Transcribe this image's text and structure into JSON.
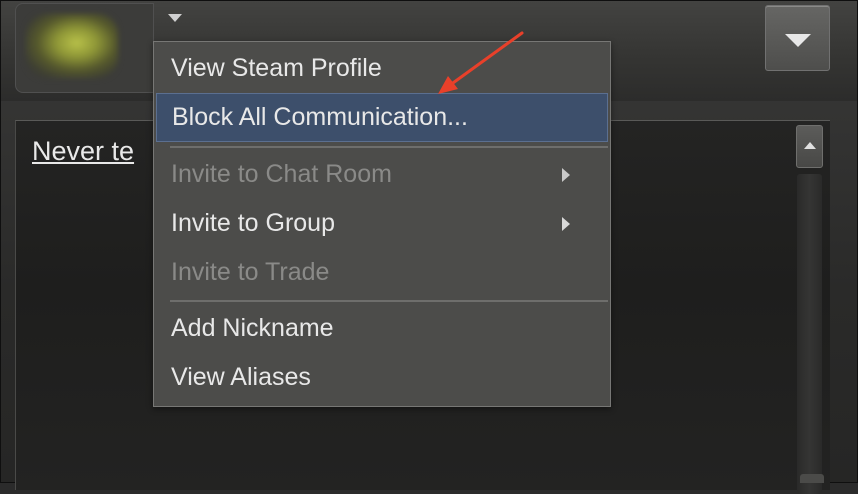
{
  "chat": {
    "link_text": "Never te"
  },
  "icons": {
    "avatar_caret": "caret-down-icon",
    "menu_toggle": "chevron-down-icon",
    "scroll_up": "scroll-up-arrow-icon",
    "submenu": "submenu-arrow-icon"
  },
  "context_menu": {
    "items": [
      {
        "label": "View Steam Profile",
        "enabled": true
      },
      {
        "label": "Block All Communication...",
        "enabled": true,
        "highlighted": true
      },
      {
        "label": "Invite to Chat Room",
        "enabled": false,
        "submenu": true
      },
      {
        "label": "Invite to Group",
        "enabled": true,
        "submenu": true
      },
      {
        "label": "Invite to Trade",
        "enabled": false
      },
      {
        "label": "Add Nickname",
        "enabled": true
      },
      {
        "label": "View Aliases",
        "enabled": true
      }
    ]
  },
  "colors": {
    "highlight": "#3d4f6b",
    "annotation_arrow": "#e8402a"
  }
}
